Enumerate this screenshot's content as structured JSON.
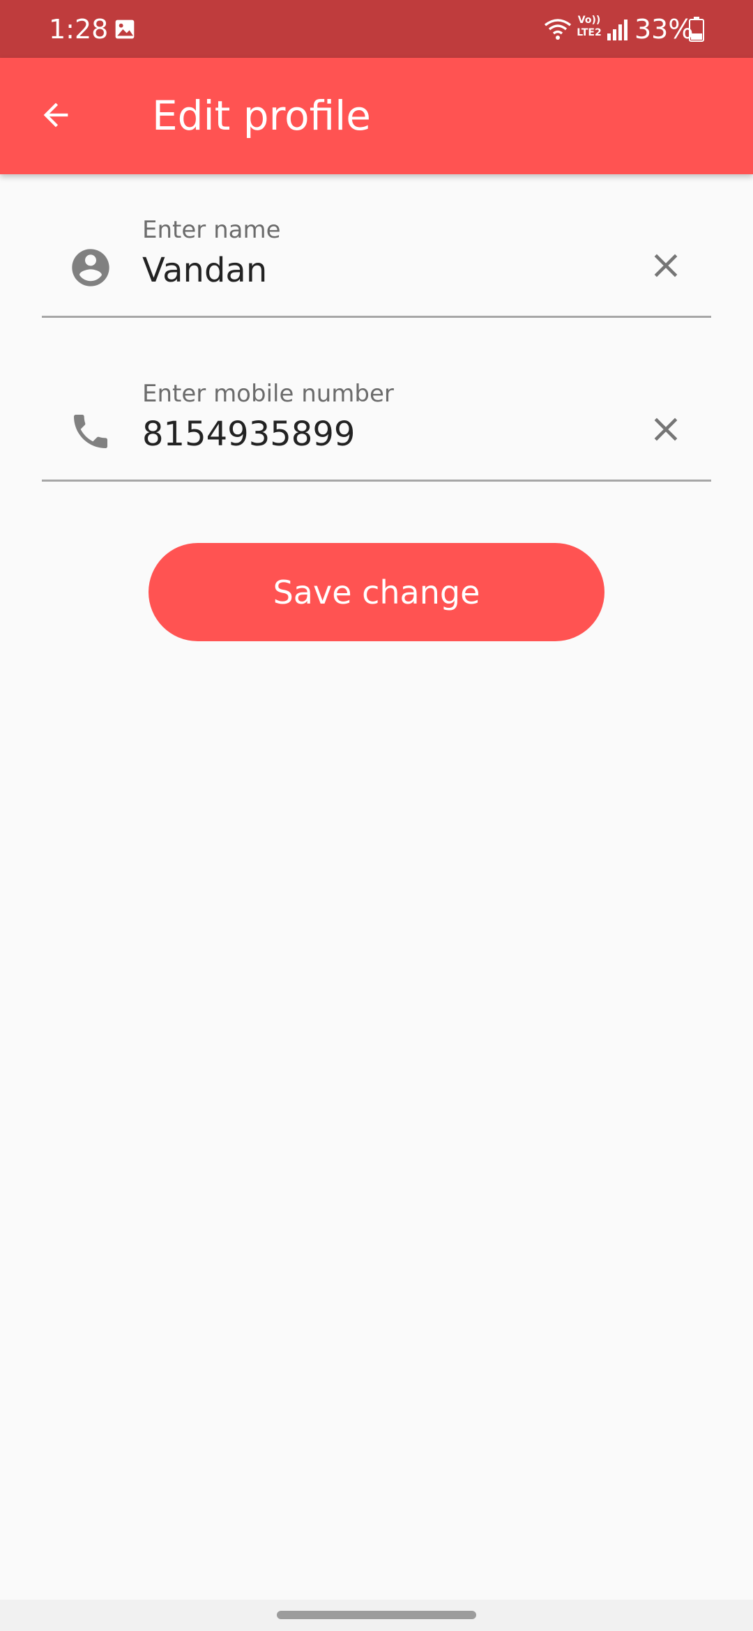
{
  "status_bar": {
    "time": "1:28",
    "volte": "Vo)) LTE2",
    "battery": "33%",
    "icons": [
      "gallery-icon",
      "wifi-icon",
      "volte-icon",
      "signal-icon",
      "battery-icon"
    ]
  },
  "app_bar": {
    "title": "Edit profile",
    "back_icon": "arrow-back-icon",
    "color": "#ff5352"
  },
  "form": {
    "name_field": {
      "label": "Enter name",
      "value": "Vandan",
      "icon": "account-circle-icon",
      "clear_icon": "close-icon"
    },
    "mobile_field": {
      "label": "Enter mobile number",
      "value": "8154935899",
      "icon": "phone-icon",
      "clear_icon": "close-icon"
    }
  },
  "save_button": {
    "label": "Save change",
    "color": "#ff5352"
  }
}
